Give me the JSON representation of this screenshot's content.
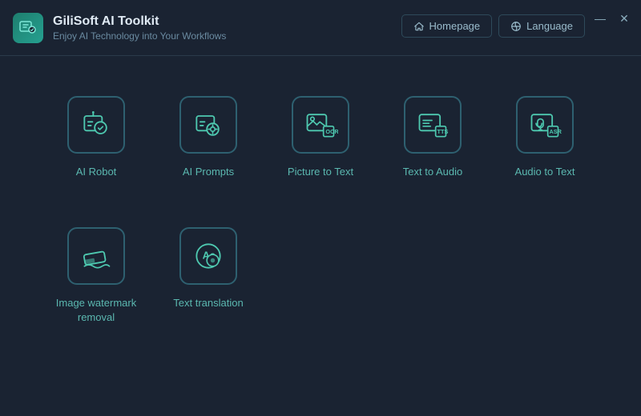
{
  "app": {
    "title": "GiliSoft AI Toolkit",
    "subtitle": "Enjoy AI Technology into Your Workflows",
    "logo_icon": "ai-logo-icon"
  },
  "nav": {
    "homepage_label": "Homepage",
    "language_label": "Language",
    "homepage_icon": "home-icon",
    "language_icon": "globe-icon"
  },
  "window_controls": {
    "minimize_label": "—",
    "close_label": "✕"
  },
  "tools": [
    {
      "id": "ai-robot",
      "label": "AI Robot",
      "icon": "ai-robot-icon"
    },
    {
      "id": "ai-prompts",
      "label": "AI Prompts",
      "icon": "ai-prompts-icon"
    },
    {
      "id": "picture-to-text",
      "label": "Picture to Text",
      "icon": "picture-to-text-icon"
    },
    {
      "id": "text-to-audio",
      "label": "Text to Audio",
      "icon": "text-to-audio-icon"
    },
    {
      "id": "audio-to-text",
      "label": "Audio to Text",
      "icon": "audio-to-text-icon"
    },
    {
      "id": "image-watermark-removal",
      "label": "Image watermark removal",
      "icon": "watermark-removal-icon"
    },
    {
      "id": "text-translation",
      "label": "Text translation",
      "icon": "text-translation-icon"
    }
  ]
}
